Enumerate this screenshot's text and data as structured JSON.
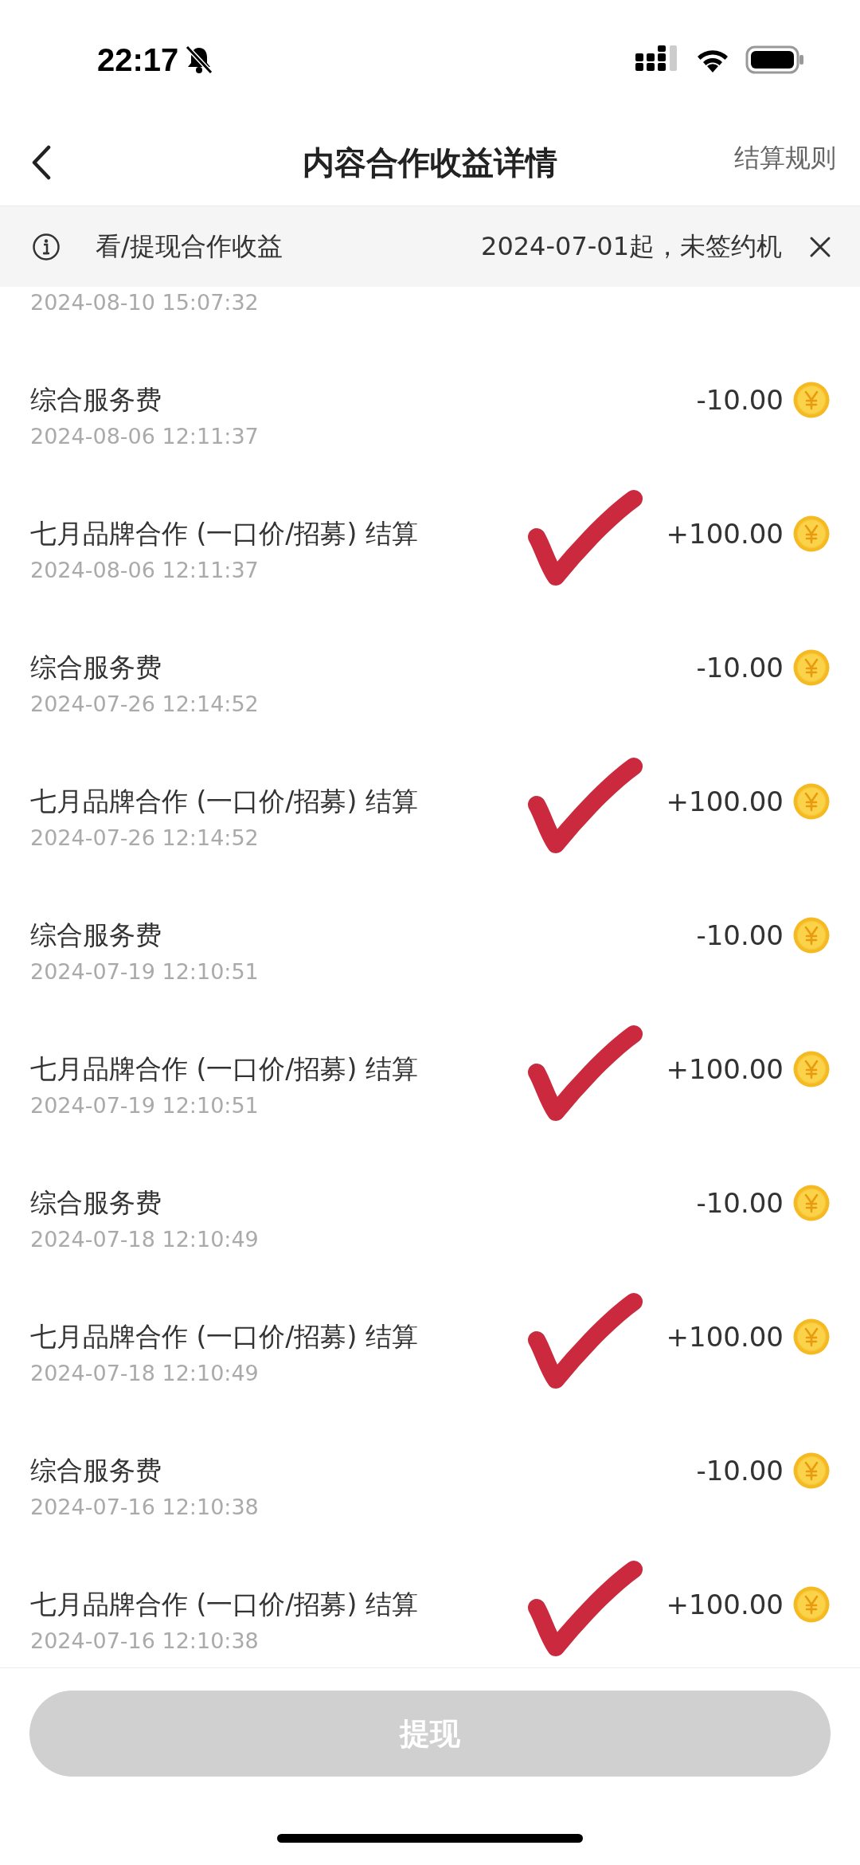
{
  "status_bar": {
    "time": "22:17"
  },
  "header": {
    "title": "内容合作收益详情",
    "action": "结算规则"
  },
  "notice": {
    "label": "看/提现合作收益",
    "message": "2024-07-01起，未签约机"
  },
  "records": [
    {
      "date": "2024-08-10 15:07:32",
      "annotated": false,
      "kind": "partial"
    },
    {
      "title": "综合服务费",
      "date": "2024-08-06 12:11:37",
      "amount": "-10.00",
      "annotated": false,
      "kind": "full"
    },
    {
      "title": "七月品牌合作 (一口价/招募) 结算",
      "date": "2024-08-06 12:11:37",
      "amount": "+100.00",
      "annotated": true,
      "kind": "full"
    },
    {
      "title": "综合服务费",
      "date": "2024-07-26 12:14:52",
      "amount": "-10.00",
      "annotated": false,
      "kind": "full"
    },
    {
      "title": "七月品牌合作 (一口价/招募) 结算",
      "date": "2024-07-26 12:14:52",
      "amount": "+100.00",
      "annotated": true,
      "kind": "full"
    },
    {
      "title": "综合服务费",
      "date": "2024-07-19 12:10:51",
      "amount": "-10.00",
      "annotated": false,
      "kind": "full"
    },
    {
      "title": "七月品牌合作 (一口价/招募) 结算",
      "date": "2024-07-19 12:10:51",
      "amount": "+100.00",
      "annotated": true,
      "kind": "full"
    },
    {
      "title": "综合服务费",
      "date": "2024-07-18 12:10:49",
      "amount": "-10.00",
      "annotated": false,
      "kind": "full"
    },
    {
      "title": "七月品牌合作 (一口价/招募) 结算",
      "date": "2024-07-18 12:10:49",
      "amount": "+100.00",
      "annotated": true,
      "kind": "full"
    },
    {
      "title": "综合服务费",
      "date": "2024-07-16 12:10:38",
      "amount": "-10.00",
      "annotated": false,
      "kind": "full"
    },
    {
      "title": "七月品牌合作 (一口价/招募) 结算",
      "date": "2024-07-16 12:10:38",
      "amount": "+100.00",
      "annotated": true,
      "kind": "full"
    }
  ],
  "withdraw_button": {
    "label": "提现",
    "disabled": true
  }
}
